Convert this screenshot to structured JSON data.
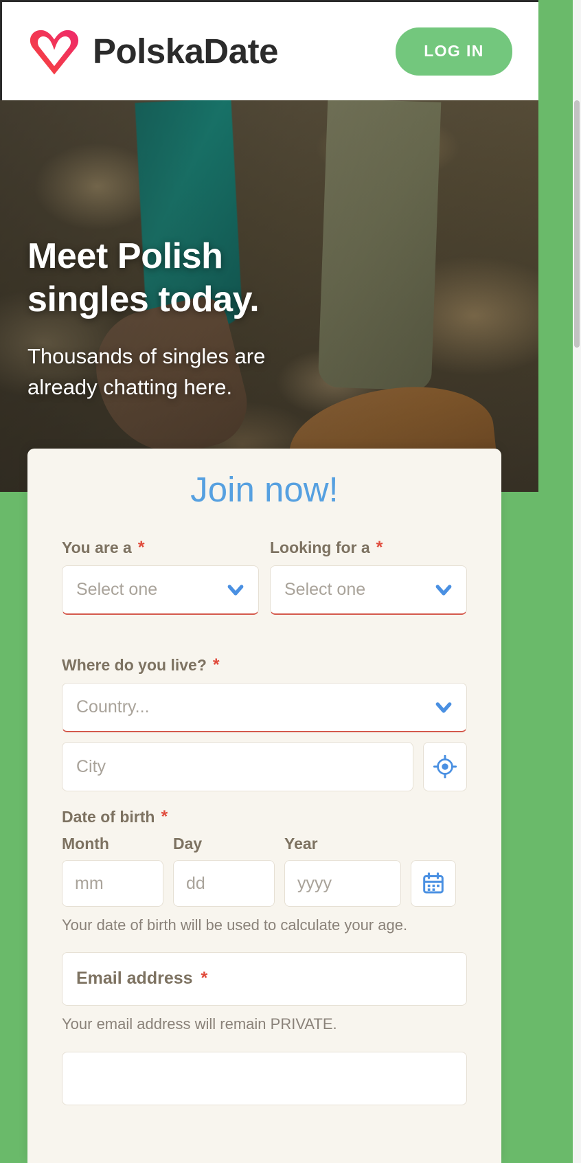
{
  "header": {
    "brand_name": "PolskaDate",
    "logo_icon": "heart-logo-icon",
    "login_label": "LOG IN"
  },
  "hero": {
    "title_line1": "Meet Polish",
    "title_line2": "singles today.",
    "subtitle_line1": "Thousands of singles are",
    "subtitle_line2": "already chatting here."
  },
  "signup": {
    "title": "Join now!",
    "required_marker": "*",
    "you_are_a": {
      "label": "You are a",
      "placeholder": "Select one",
      "icon": "chevron-down-icon"
    },
    "looking_for_a": {
      "label": "Looking for a",
      "placeholder": "Select one",
      "icon": "chevron-down-icon"
    },
    "location": {
      "label": "Where do you live?",
      "country_placeholder": "Country...",
      "country_icon": "chevron-down-icon",
      "city_placeholder": "City",
      "geolocate_icon": "crosshair-location-icon"
    },
    "dob": {
      "label": "Date of birth",
      "month_header": "Month",
      "day_header": "Day",
      "year_header": "Year",
      "month_placeholder": "mm",
      "day_placeholder": "dd",
      "year_placeholder": "yyyy",
      "calendar_icon": "calendar-icon",
      "help": "Your date of birth will be used to calculate your age."
    },
    "email": {
      "label": "Email address",
      "value": "",
      "help": "Your email address will remain PRIVATE."
    }
  },
  "colors": {
    "brand_green": "#73c77d",
    "page_green": "#6aba6a",
    "card_bg": "#f8f5ee",
    "join_blue": "#56a0e0",
    "accent_blue": "#4a90e2",
    "required_red": "#e04b3c",
    "label_brown": "#7d7261",
    "logo_pink": "#ee2a6b",
    "logo_red": "#f6443b"
  }
}
